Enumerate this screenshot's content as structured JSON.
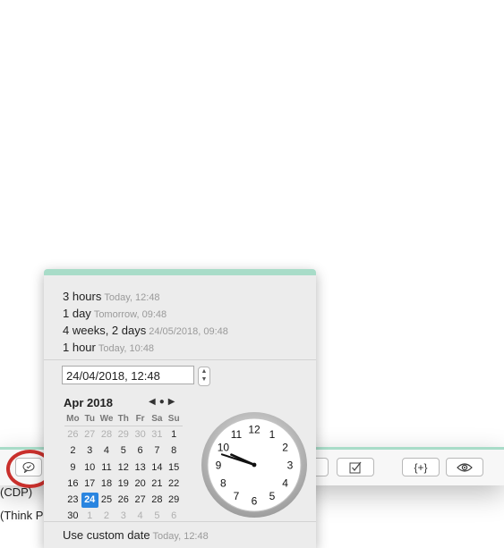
{
  "presets": [
    {
      "label": "3 hours",
      "detail": "Today, 12:48"
    },
    {
      "label": "1 day",
      "detail": "Tomorrow, 09:48"
    },
    {
      "label": "4 weeks, 2 days",
      "detail": "24/05/2018, 09:48"
    },
    {
      "label": "1 hour",
      "detail": "Today, 10:48"
    }
  ],
  "date_field": {
    "value": "24/04/2018, 12:48"
  },
  "calendar": {
    "month_label": "Apr 2018",
    "nav": {
      "prev": "◀",
      "today": "●",
      "next": "▶"
    },
    "weekdays": [
      "Mo",
      "Tu",
      "We",
      "Th",
      "Fr",
      "Sa",
      "Su"
    ],
    "weeks": [
      [
        "26",
        "27",
        "28",
        "29",
        "30",
        "31",
        "1"
      ],
      [
        "2",
        "3",
        "4",
        "5",
        "6",
        "7",
        "8"
      ],
      [
        "9",
        "10",
        "11",
        "12",
        "13",
        "14",
        "15"
      ],
      [
        "16",
        "17",
        "18",
        "19",
        "20",
        "21",
        "22"
      ],
      [
        "23",
        "24",
        "25",
        "26",
        "27",
        "28",
        "29"
      ],
      [
        "30",
        "1",
        "2",
        "3",
        "4",
        "5",
        "6"
      ]
    ],
    "selected": "24"
  },
  "clock": {
    "numbers": [
      "12",
      "1",
      "2",
      "3",
      "4",
      "5",
      "6",
      "7",
      "8",
      "9",
      "10",
      "11"
    ],
    "hour": 9,
    "minute": 48
  },
  "footer": {
    "label": "Use custom date",
    "detail": "Today, 12:48"
  },
  "background": {
    "row1": "(CDP)",
    "row2": "(Think P",
    "insert_label": "{+}"
  },
  "colors": {
    "accent": "#a8dcc8",
    "selected": "#2a85e0",
    "highlight_ring": "#c9302c"
  }
}
